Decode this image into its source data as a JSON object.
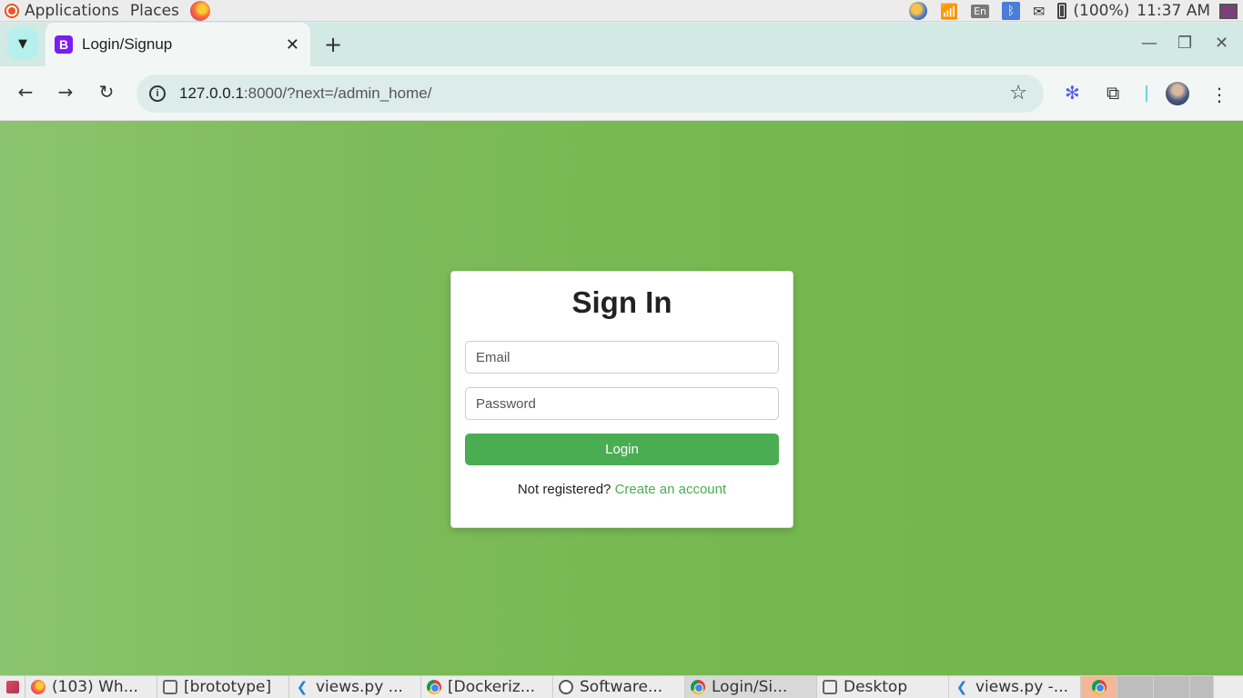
{
  "system_panel": {
    "applications_label": "Applications",
    "places_label": "Places",
    "language_indicator": "En",
    "battery_text": "(100%)",
    "clock": "11:37 AM"
  },
  "browser": {
    "tab": {
      "favicon_letter": "B",
      "title": "Login/Signup",
      "close_glyph": "✕"
    },
    "new_tab_glyph": "+",
    "window_buttons": {
      "minimize": "—",
      "maximize": "❐",
      "close": "✕"
    },
    "toolbar": {
      "back_glyph": "←",
      "forward_glyph": "→",
      "reload_glyph": "↻",
      "url_host": "127.0.0.1",
      "url_rest": ":8000/?next=/admin_home/",
      "star_glyph": "☆",
      "extension_glyph": "✻",
      "puzzle_glyph": "⧉",
      "menu_glyph": "⋮"
    }
  },
  "login_card": {
    "title": "Sign In",
    "email_placeholder": "Email",
    "password_placeholder": "Password",
    "login_button": "Login",
    "register_prompt": "Not registered?",
    "register_link": "Create an account"
  },
  "taskbar": {
    "items": [
      {
        "label": "(103) Wh...",
        "icon": "firefox-icon"
      },
      {
        "label": "[brototype]",
        "icon": "window-icon"
      },
      {
        "label": "views.py ...",
        "icon": "vscode-icon"
      },
      {
        "label": "[Dockeriz...",
        "icon": "chrome-icon"
      },
      {
        "label": "Software...",
        "icon": "software-icon"
      },
      {
        "label": "Login/Si...",
        "icon": "chrome-icon"
      },
      {
        "label": "Desktop",
        "icon": "window-icon"
      },
      {
        "label": "views.py -...",
        "icon": "vscode-icon"
      }
    ]
  },
  "colors": {
    "page_background": "#76b850",
    "accent_green": "#4aad52",
    "tab_strip": "#d3e9e4"
  }
}
